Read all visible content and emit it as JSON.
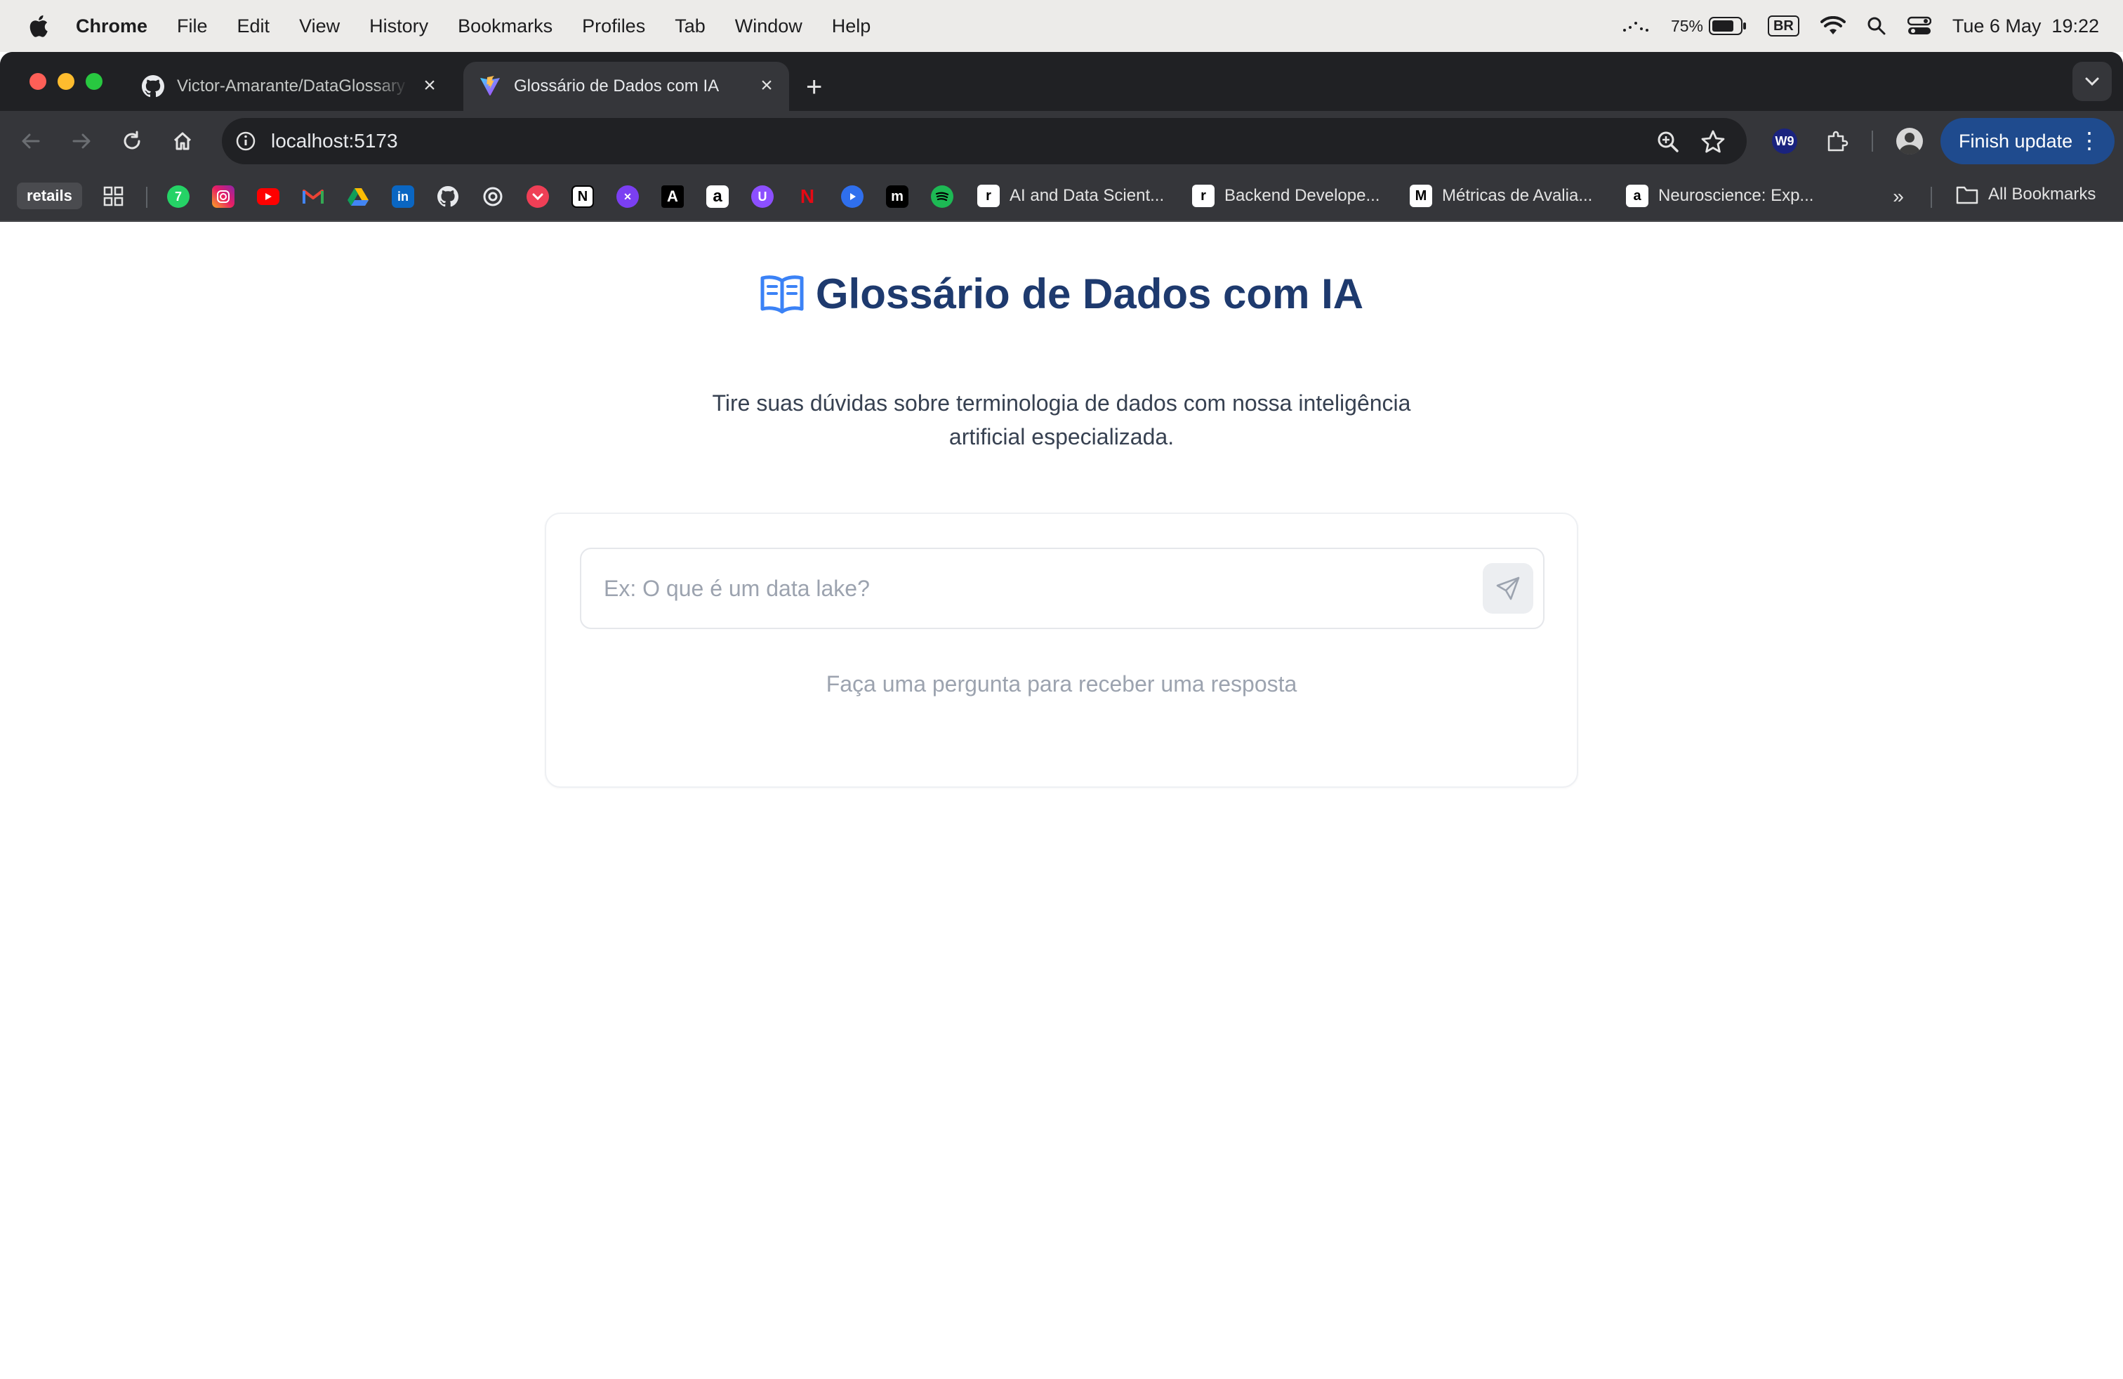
{
  "menubar": {
    "app_name": "Chrome",
    "items": [
      "File",
      "Edit",
      "View",
      "History",
      "Bookmarks",
      "Profiles",
      "Tab",
      "Window",
      "Help"
    ],
    "battery_percent": "75%",
    "input_source": "BR",
    "datetime": "Tue 6 May  19:22"
  },
  "tabs": [
    {
      "title": "Victor-Amarante/DataGlossary",
      "favicon": "github-icon",
      "active": false
    },
    {
      "title": "Glossário de Dados com IA",
      "favicon": "vite-icon",
      "active": true
    }
  ],
  "toolbar": {
    "url": "localhost:5173",
    "finish_update_label": "Finish update",
    "extension_label": "W9"
  },
  "bookmarks": {
    "folder_label": "retails",
    "labeled": [
      {
        "label": "AI and Data Scient...",
        "icon": "r"
      },
      {
        "label": "Backend Develope...",
        "icon": "r"
      },
      {
        "label": "Métricas de Avalia...",
        "icon": "M"
      },
      {
        "label": "Neuroscience: Exp...",
        "icon": "a"
      }
    ],
    "all_bookmarks_label": "All Bookmarks",
    "favicons": [
      "whatsapp-icon",
      "instagram-icon",
      "youtube-icon",
      "gmail-icon",
      "google-drive-icon",
      "linkedin-icon",
      "github-icon",
      "openai-icon",
      "pocket-icon",
      "notion-icon",
      "app-icon",
      "anthropic-icon",
      "amazon-icon",
      "podcast-icon",
      "netflix-icon",
      "play-icon",
      "medium-icon",
      "spotify-icon"
    ]
  },
  "app": {
    "title": "Glossário de Dados com IA",
    "subtitle": "Tire suas dúvidas sobre terminologia de dados com nossa inteligência artificial especializada.",
    "input_placeholder": "Ex: O que é um data lake?",
    "input_value": "",
    "empty_state": "Faça uma pergunta para receber uma resposta",
    "accent_color": "#1e3a6e",
    "icon_color": "#3b82f6"
  }
}
